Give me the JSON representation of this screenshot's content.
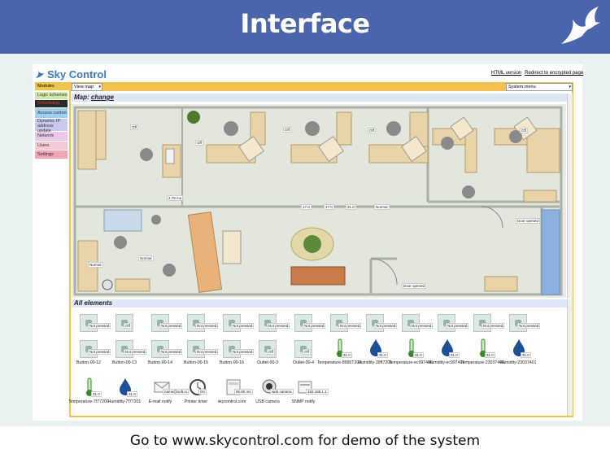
{
  "banner": {
    "title": "Interface"
  },
  "footer": {
    "text": "Go to www.skycontrol.com for demo of the system"
  },
  "app": {
    "logo": "Sky Control",
    "top_links": [
      "HTML version",
      "Redirect to encrypted page"
    ],
    "modules_label": "Modules",
    "sidebar": [
      {
        "label": "Logic schemes",
        "bg": "#cfe9a8",
        "color": "#333"
      },
      {
        "label": "Scheduling",
        "bg": "#2a2a2a",
        "color": "#e0403a"
      },
      {
        "label": "Access control",
        "bg": "#9fd0f0",
        "color": "#333"
      },
      {
        "label": "Dynamic IP address update",
        "bg": "#c9c9ef",
        "color": "#333"
      },
      {
        "label": "Network",
        "bg": "#e9c8e9",
        "color": "#333"
      },
      {
        "label": "Users",
        "bg": "#f5c9d6",
        "color": "#333"
      },
      {
        "label": "Settings",
        "bg": "#f2a5b6",
        "color": "#333"
      }
    ],
    "view_select": "View map",
    "system_menu": "System menu",
    "map_header": "Map:",
    "map_change": "change",
    "elements_header": "All elements"
  },
  "map_labels": {
    "off": "Off",
    "normal": "Normal",
    "door_opened": "Door opened",
    "temp_value": "2.79 mu",
    "t1": "17.0",
    "t2": "17.0",
    "t3": "31.0",
    "led": "31.0"
  },
  "elements": {
    "row1_label": "Not pressed",
    "row1_off": "Off",
    "row2": [
      {
        "kind": "button",
        "label": "Button-00-12"
      },
      {
        "kind": "button",
        "label": "Button-00-13"
      },
      {
        "kind": "button",
        "label": "Button-00-14"
      },
      {
        "kind": "button",
        "label": "Button-00-15"
      },
      {
        "kind": "button",
        "label": "Button-00-16"
      },
      {
        "kind": "outlet",
        "label": "Outlet-00-3"
      },
      {
        "kind": "outlet",
        "label": "Outlet-00-4"
      },
      {
        "kind": "thermo",
        "label": "Temperature-8995T200",
        "value": "31.0"
      },
      {
        "kind": "drop",
        "label": "Humidity-39ff7201",
        "value": "31.0"
      },
      {
        "kind": "thermo",
        "label": "Temperature-ec997400",
        "value": "31.0"
      },
      {
        "kind": "drop",
        "label": "Humidity-ec997401",
        "value": "31.0"
      },
      {
        "kind": "thermo",
        "label": "Temperature-23037400",
        "value": "31.0"
      },
      {
        "kind": "drop",
        "label": "Humidity-23037401",
        "value": "31.0"
      }
    ],
    "row3": [
      {
        "kind": "thermo",
        "label": "Temperature-7f77200",
        "value": "31.0"
      },
      {
        "kind": "drop",
        "label": "Humidity-7f77201",
        "value": "31.0"
      },
      {
        "kind": "mail",
        "label": "E-mail notify",
        "tag": "name@soft.ru"
      },
      {
        "kind": "clock",
        "label": "Printer timer",
        "tag": "On"
      },
      {
        "kind": "web",
        "label": "skycontrol.com",
        "tag": "86.80 ms"
      },
      {
        "kind": "cam",
        "label": "USB camera",
        "tag": "web camera"
      },
      {
        "kind": "snmp",
        "label": "SNMP notify",
        "tag": "192.168.1.1"
      }
    ]
  }
}
